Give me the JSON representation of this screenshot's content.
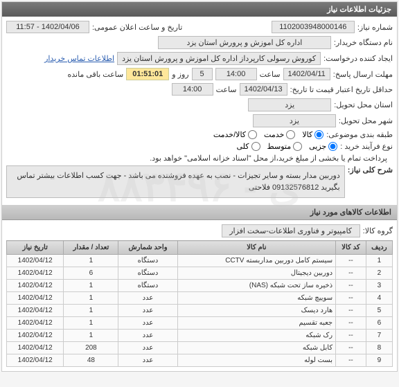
{
  "panel": {
    "title": "جزئیات اطلاعات نیاز"
  },
  "labels": {
    "need_no": "شماره نیاز:",
    "public_announce": "تاریخ و ساعت اعلان عمومی:",
    "buyer_name": "نام دستگاه خریدار:",
    "creator": "ایجاد کننده درخواست:",
    "contact_info": "اطلاعات تماس خریدار",
    "reply_deadline": "مهلت ارسال پاسخ:",
    "at_hour": "ساعت",
    "and": "و",
    "day": "روز و",
    "remaining": "ساعت باقی مانده",
    "validity_min": "حداقل تاریخ اعتبار قیمت تا تاریخ:",
    "req_province": "استان محل تحویل:",
    "req_city": "شهر محل تحویل:",
    "delivery_method": "طبقه بندی موضوعی:",
    "purchase_type": "نوع فرآیند خرید :",
    "payment_note": "پرداخت تمام یا بخشی از مبلغ خرید،از محل \"اسناد خزانه اسلامی\" خواهد بود.",
    "need_desc_title": "شرح کلی نیاز:",
    "item_group": "گروه کالا:",
    "goods_section": "اطلاعات کالاهای مورد نیاز"
  },
  "fields": {
    "need_no": "1102003948000146",
    "public_announce": "1402/04/06 - 11:57",
    "buyer_name": "اداره کل اموزش و پرورش استان یزد",
    "creator": "کوروش رسولی کارپرداز اداره کل اموزش و پرورش استان یزد",
    "reply_date": "1402/04/11",
    "reply_time": "14:00",
    "days_left": "5",
    "countdown": "01:51:01",
    "validity_date": "1402/04/13",
    "validity_time": "14:00",
    "province": "یزد",
    "city": "یزد",
    "item_group": "کامپیوتر و فناوری اطلاعات-سخت افزار"
  },
  "delivery_options": {
    "opt1": "کالا",
    "opt2": "خدمت",
    "opt3": "کالا/خدمت"
  },
  "purchase_options": {
    "opt1": "جزیی",
    "opt2": "متوسط",
    "opt3": "کلی"
  },
  "need_desc": "دوربین مدار بسته و سایر تجیزات - نصب به عهده فروشنده می باشد - جهت کسب اطلاعات بیشتر تماس بگیرید 09132576812 فلاحتی",
  "table": {
    "headers": {
      "row": "ردیف",
      "code": "کد کالا",
      "name": "نام کالا",
      "unit": "واحد شمارش",
      "qty": "تعداد / مقدار",
      "date": "تاریخ نیاز"
    },
    "rows": [
      {
        "n": "1",
        "code": "--",
        "name": "سیستم کامل دوربین مداربسته CCTV",
        "unit": "دستگاه",
        "qty": "1",
        "date": "1402/04/12"
      },
      {
        "n": "2",
        "code": "--",
        "name": "دوربین دیجیتال",
        "unit": "دستگاه",
        "qty": "6",
        "date": "1402/04/12"
      },
      {
        "n": "3",
        "code": "--",
        "name": "ذخیره ساز تحت شبکه (NAS)",
        "unit": "دستگاه",
        "qty": "1",
        "date": "1402/04/12"
      },
      {
        "n": "4",
        "code": "--",
        "name": "سوییچ شبکه",
        "unit": "عدد",
        "qty": "1",
        "date": "1402/04/12"
      },
      {
        "n": "5",
        "code": "--",
        "name": "هارد دیسک",
        "unit": "عدد",
        "qty": "1",
        "date": "1402/04/12"
      },
      {
        "n": "6",
        "code": "--",
        "name": "جعبه تقسیم",
        "unit": "عدد",
        "qty": "1",
        "date": "1402/04/12"
      },
      {
        "n": "7",
        "code": "--",
        "name": "رک شبکه",
        "unit": "عدد",
        "qty": "1",
        "date": "1402/04/12"
      },
      {
        "n": "8",
        "code": "--",
        "name": "کابل شبکه",
        "unit": "عدد",
        "qty": "208",
        "date": "1402/04/12"
      },
      {
        "n": "9",
        "code": "--",
        "name": "بست لوله",
        "unit": "عدد",
        "qty": "48",
        "date": "1402/04/12"
      }
    ]
  }
}
